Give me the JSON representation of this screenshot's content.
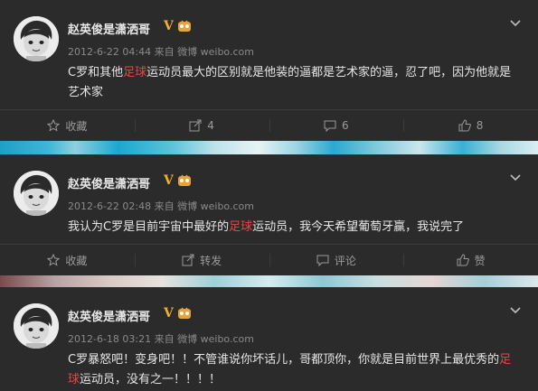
{
  "posts": [
    {
      "author": "赵英俊是潇洒哥",
      "badge": "V",
      "time": "2012-6-22 04:44",
      "source_prefix": "来自",
      "source": "微博 weibo.com",
      "text_before": "C罗和其他",
      "text_highlight": "足球",
      "text_after": "运动员最大的区别就是他装的逼都是艺术家的逼，忍了吧，因为他就是艺术家",
      "actions": {
        "favorite": "收藏",
        "repost": "4",
        "comment": "6",
        "like": "8"
      }
    },
    {
      "author": "赵英俊是潇洒哥",
      "badge": "V",
      "time": "2012-6-22 02:48",
      "source_prefix": "来自",
      "source": "微博 weibo.com",
      "text_before": "我认为C罗是目前宇宙中最好的",
      "text_highlight": "足球",
      "text_after": "运动员，我今天希望葡萄牙赢，我说完了",
      "actions": {
        "favorite": "收藏",
        "repost": "转发",
        "comment": "评论",
        "like": "赞"
      }
    },
    {
      "author": "赵英俊是潇洒哥",
      "badge": "V",
      "time": "2012-6-18 03:21",
      "source_prefix": "来自",
      "source": "微博 weibo.com",
      "text_before": "C罗暴怒吧！变身吧！！不管谁说你坏话儿，哥都顶你，你就是目前世界上最优秀的",
      "text_highlight": "足球",
      "text_after": "运动员，没有之一！！！！",
      "actions": null
    }
  ],
  "colors": {
    "highlight": "#e84545",
    "badge": "#f3b02c",
    "background": "#2b2b2b"
  }
}
